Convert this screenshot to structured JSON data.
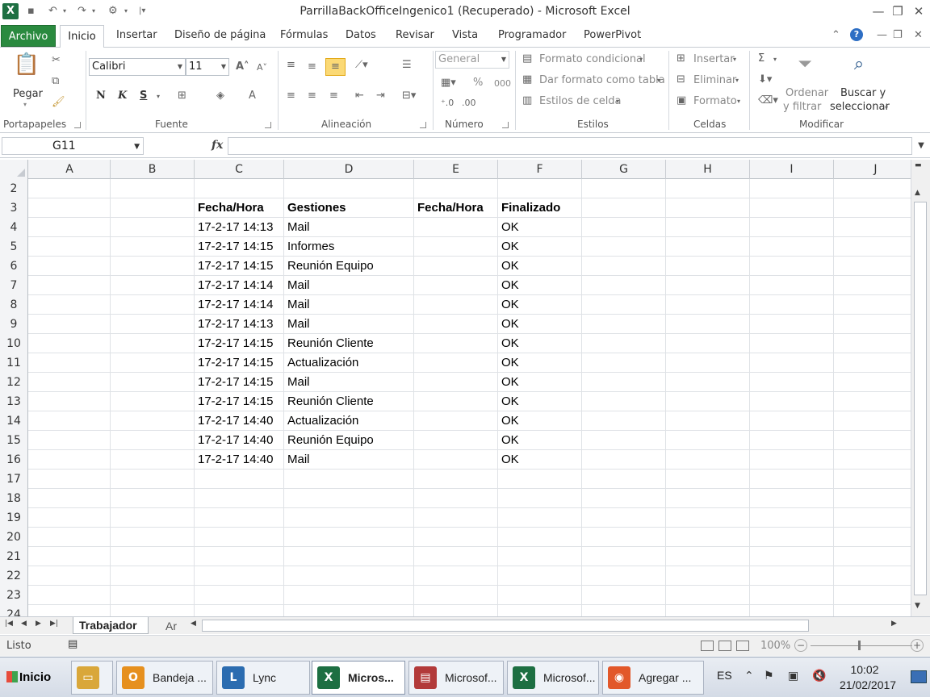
{
  "window": {
    "title": "ParrillaBackOfficeIngenico1 (Recuperado)  -  Microsoft Excel",
    "app_icon": "X"
  },
  "ribbon_tabs": {
    "file": "Archivo",
    "home": "Inicio",
    "others": [
      "Insertar",
      "Diseño de página",
      "Fórmulas",
      "Datos",
      "Revisar",
      "Vista",
      "Programador",
      "PowerPivot"
    ]
  },
  "ribbon": {
    "clipboard": {
      "paste": "Pegar",
      "label": "Portapapeles"
    },
    "font": {
      "name": "Calibri",
      "size": "11",
      "bold": "N",
      "italic": "K",
      "underline": "S",
      "label": "Fuente"
    },
    "alignment": {
      "label": "Alineación"
    },
    "number": {
      "format": "General",
      "percent": "%",
      "thousands": "000",
      "label": "Número"
    },
    "styles": {
      "conditional": "Formato condicional",
      "as_table": "Dar formato como tabla",
      "cell_styles": "Estilos de celda",
      "label": "Estilos"
    },
    "cells": {
      "insert": "Insertar",
      "delete": "Eliminar",
      "format": "Formato",
      "label": "Celdas"
    },
    "editing": {
      "sum": "Σ",
      "sort_line1": "Ordenar",
      "sort_line2": "y filtrar",
      "find_line1": "Buscar y",
      "find_line2": "seleccionar",
      "label": "Modificar"
    }
  },
  "formula_bar": {
    "name_box": "G11",
    "fx": "fx",
    "formula": ""
  },
  "columns": [
    "A",
    "B",
    "C",
    "D",
    "E",
    "F",
    "G",
    "H",
    "I",
    "J"
  ],
  "rows": [
    {
      "num": "2",
      "C": "",
      "D": "",
      "E": "",
      "F": ""
    },
    {
      "num": "3",
      "C": "Fecha/Hora",
      "D": "Gestiones",
      "E": "Fecha/Hora",
      "F": "Finalizado",
      "header": true
    },
    {
      "num": "4",
      "C": "17-2-17 14:13",
      "D": "Mail",
      "E": "",
      "F": "OK"
    },
    {
      "num": "5",
      "C": "17-2-17 14:15",
      "D": "Informes",
      "E": "",
      "F": "OK"
    },
    {
      "num": "6",
      "C": "17-2-17 14:15",
      "D": "Reunión Equipo",
      "E": "",
      "F": "OK"
    },
    {
      "num": "7",
      "C": "17-2-17 14:14",
      "D": "Mail",
      "E": "",
      "F": "OK"
    },
    {
      "num": "8",
      "C": "17-2-17 14:14",
      "D": "Mail",
      "E": "",
      "F": "OK"
    },
    {
      "num": "9",
      "C": "17-2-17 14:13",
      "D": "Mail",
      "E": "",
      "F": "OK"
    },
    {
      "num": "10",
      "C": "17-2-17 14:15",
      "D": "Reunión Cliente",
      "E": "",
      "F": "OK"
    },
    {
      "num": "11",
      "C": "17-2-17 14:15",
      "D": "Actualización",
      "E": "",
      "F": "OK"
    },
    {
      "num": "12",
      "C": "17-2-17 14:15",
      "D": "Mail",
      "E": "",
      "F": "OK"
    },
    {
      "num": "13",
      "C": "17-2-17 14:15",
      "D": "Reunión Cliente",
      "E": "",
      "F": "OK"
    },
    {
      "num": "14",
      "C": "17-2-17 14:40",
      "D": "Actualización",
      "E": "",
      "F": "OK"
    },
    {
      "num": "15",
      "C": "17-2-17 14:40",
      "D": "Reunión Equipo",
      "E": "",
      "F": "OK"
    },
    {
      "num": "16",
      "C": "17-2-17 14:40",
      "D": "Mail",
      "E": "",
      "F": "OK"
    },
    {
      "num": "17"
    },
    {
      "num": "18"
    },
    {
      "num": "19"
    },
    {
      "num": "20"
    },
    {
      "num": "21"
    },
    {
      "num": "22"
    },
    {
      "num": "23"
    },
    {
      "num": "24"
    }
  ],
  "sheets": {
    "active": "Trabajador",
    "second": "Ar"
  },
  "status": {
    "text": "Listo",
    "zoom": "100%"
  },
  "taskbar": {
    "start": "Inicio",
    "items": [
      {
        "label": "",
        "icon": "folder-icon",
        "color": "#d9a73a"
      },
      {
        "label": "Bandeja ...",
        "icon": "outlook-icon",
        "color": "#e6901e"
      },
      {
        "label": "Lync",
        "icon": "lync-icon",
        "color": "#2b6cb0"
      },
      {
        "label": "Micros...",
        "icon": "excel-icon",
        "color": "#1d6f42",
        "active": true
      },
      {
        "label": "Microsof...",
        "icon": "project-icon",
        "color": "#b23a3a"
      },
      {
        "label": "Microsof...",
        "icon": "excel-icon",
        "color": "#1d6f42"
      },
      {
        "label": "Agregar ...",
        "icon": "firefox-icon",
        "color": "#e2582a"
      }
    ],
    "lang": "ES",
    "time": "10:02",
    "date": "21/02/2017"
  },
  "colors": {
    "file_tab": "#2a8a3f",
    "header_bg": "#f3f4f6",
    "accent": "#1d6f42"
  }
}
